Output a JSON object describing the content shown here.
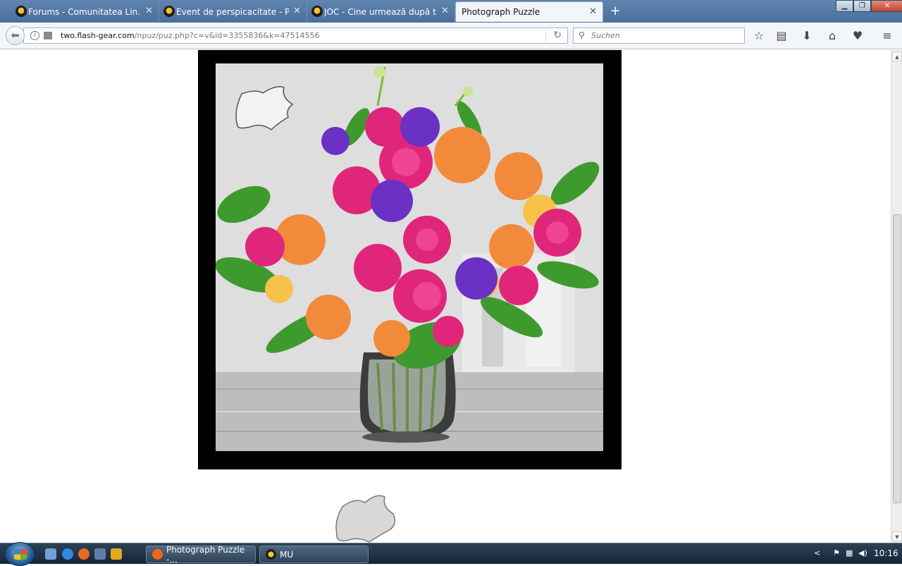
{
  "tabs": [
    {
      "title": "Forums - Comunitatea Lin...",
      "active": false
    },
    {
      "title": "Event de perspicacitate - P...",
      "active": false
    },
    {
      "title": "JOC - Cine urmează după t...",
      "active": false
    },
    {
      "title": "Photograph Puzzle",
      "active": true
    }
  ],
  "tab_close_glyph": "✕",
  "new_tab_glyph": "+",
  "window_controls": {
    "minimize": "▁",
    "restore": "❐",
    "close": "✕"
  },
  "navbar": {
    "url_host": "two.flash-gear.com",
    "url_path": "/npuz/puz.php?c=v&id=3355836&k=47514556",
    "search_placeholder": "Suchen",
    "toolbar_icons": [
      "bookmark-star-icon",
      "reading-list-icon",
      "downloads-icon",
      "home-icon",
      "pocket-icon",
      "menu-icon"
    ]
  },
  "taskbar": {
    "tasks": [
      {
        "label": "Photograph Puzzle -...",
        "icon": "firefox-icon"
      },
      {
        "label": "MU",
        "icon": "game-icon"
      }
    ],
    "clock": "10:16",
    "tray_chevron": "<"
  },
  "colors": {
    "tab_strip": "#5f84b0",
    "puzzle_frame": "#000000",
    "taskbar": "#1e3044"
  }
}
